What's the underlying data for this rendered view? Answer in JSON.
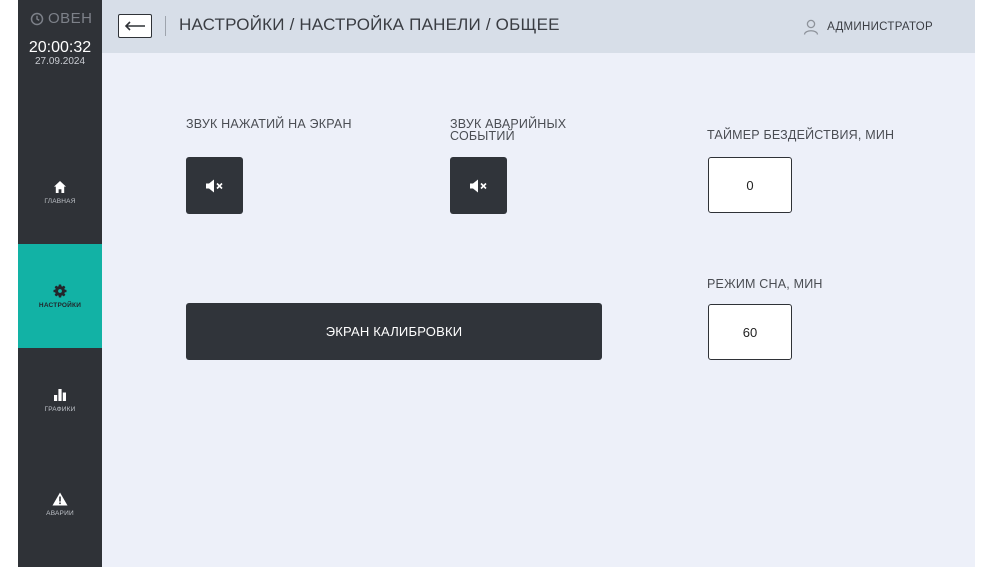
{
  "brand": {
    "logo_text": "ОВЕН"
  },
  "clock": {
    "time": "20:00:32",
    "date": "27.09.2024"
  },
  "nav": [
    {
      "label": "ГЛАВНАЯ",
      "icon": "home-icon"
    },
    {
      "label": "НАСТРОЙКИ",
      "icon": "gear-icon",
      "active": true
    },
    {
      "label": "ГРАФИКИ",
      "icon": "bar-chart-icon"
    },
    {
      "label": "АВАРИИ",
      "icon": "warning-icon"
    }
  ],
  "header": {
    "back_icon": "back-arrow-icon",
    "breadcrumb": "НАСТРОЙКИ / НАСТРОЙКА ПАНЕЛИ / ОБЩЕЕ",
    "user": "АДМИНИСТРАТОР",
    "user_icon": "user-icon"
  },
  "settings": {
    "touch_sound_label": "ЗВУК НАЖАТИЙ НА ЭКРАН",
    "touch_sound_icon": "speaker-muted-icon",
    "alarm_sound_label": "ЗВУК АВАРИЙНЫХ СОБЫТИЙ",
    "alarm_sound_icon": "speaker-muted-icon",
    "idle_timer_label": "ТАЙМЕР БЕЗДЕЙСТВИЯ, МИН",
    "idle_timer_value": "0",
    "sleep_label": "РЕЖИМ СНА, МИН",
    "sleep_value": "60",
    "calibration_button": "ЭКРАН КАЛИБРОВКИ"
  },
  "colors": {
    "sidebar": "#2f3237",
    "accent": "#12b2a5",
    "background": "#edf0f9",
    "header": "#d7dee8",
    "button": "#30343a"
  }
}
